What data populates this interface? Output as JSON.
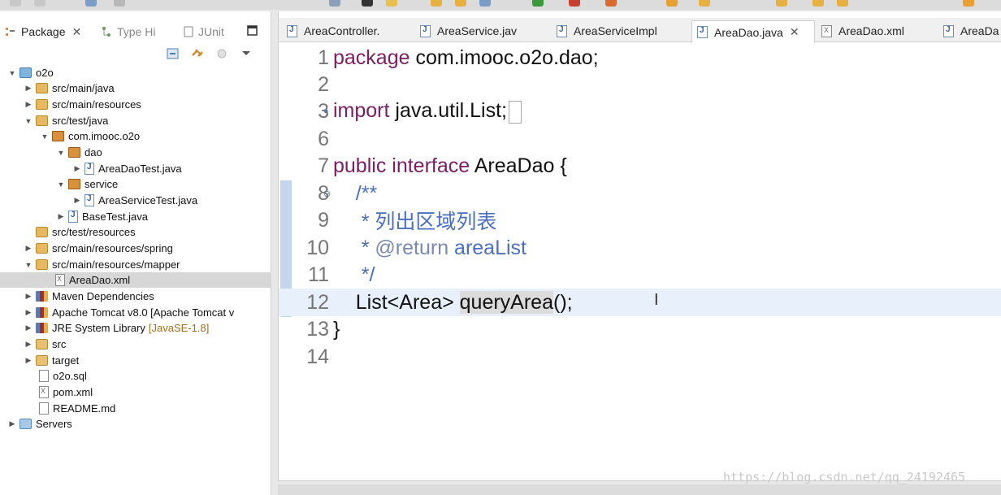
{
  "left_panel": {
    "tabs": [
      {
        "label": "Package",
        "close": "✕"
      },
      {
        "label": "Type Hi"
      },
      {
        "label": "JUnit"
      }
    ],
    "tree": [
      {
        "label": "o2o",
        "arrow": "▼",
        "icon": "project-icon"
      },
      {
        "label": "src/main/java",
        "arrow": "▶",
        "icon": "source-folder-icon"
      },
      {
        "label": "src/main/resources",
        "arrow": "▶",
        "icon": "source-folder-icon"
      },
      {
        "label": "src/test/java",
        "arrow": "▼",
        "icon": "source-folder-icon"
      },
      {
        "label": "com.imooc.o2o",
        "arrow": "▼",
        "icon": "package-icon"
      },
      {
        "label": "dao",
        "arrow": "▼",
        "icon": "package-icon"
      },
      {
        "label": "AreaDaoTest.java",
        "arrow": "▶",
        "icon": "java-file-icon"
      },
      {
        "label": "service",
        "arrow": "▼",
        "icon": "package-icon"
      },
      {
        "label": "AreaServiceTest.java",
        "arrow": "▶",
        "icon": "java-file-icon"
      },
      {
        "label": "BaseTest.java",
        "arrow": "▶",
        "icon": "java-file-icon"
      },
      {
        "label": "src/test/resources",
        "arrow": "",
        "icon": "source-folder-icon"
      },
      {
        "label": "src/main/resources/spring",
        "arrow": "▶",
        "icon": "source-folder-icon"
      },
      {
        "label": "src/main/resources/mapper",
        "arrow": "▼",
        "icon": "source-folder-icon"
      },
      {
        "label": "AreaDao.xml",
        "arrow": "",
        "icon": "xml-file-icon"
      },
      {
        "label": "Maven Dependencies",
        "arrow": "▶",
        "icon": "library-icon"
      },
      {
        "label": "Apache Tomcat v8.0 [Apache Tomcat v",
        "arrow": "▶",
        "icon": "library-icon"
      },
      {
        "label": "JRE System Library",
        "suffix": "[JavaSE-1.8]",
        "arrow": "▶",
        "icon": "library-icon"
      },
      {
        "label": "src",
        "arrow": "▶",
        "icon": "folder-icon"
      },
      {
        "label": "target",
        "arrow": "▶",
        "icon": "folder-icon"
      },
      {
        "label": "o2o.sql",
        "arrow": "",
        "icon": "file-icon"
      },
      {
        "label": "pom.xml",
        "arrow": "",
        "icon": "xml-file-icon"
      },
      {
        "label": "README.md",
        "arrow": "",
        "icon": "file-icon"
      },
      {
        "label": "Servers",
        "arrow": "▶",
        "icon": "servers-folder-icon"
      }
    ]
  },
  "editor": {
    "tabs": [
      {
        "label": "AreaController.",
        "kind": "java"
      },
      {
        "label": "AreaService.jav",
        "kind": "java"
      },
      {
        "label": "AreaServiceImpl",
        "kind": "java"
      },
      {
        "label": "AreaDao.java",
        "kind": "java",
        "close": "✕"
      },
      {
        "label": "AreaDao.xml",
        "kind": "xml"
      },
      {
        "label": "AreaDa",
        "kind": "java"
      }
    ],
    "line_numbers": [
      "1",
      "2",
      "3",
      "6",
      "7",
      "8",
      "9",
      "10",
      "11",
      "12",
      "13",
      "14"
    ],
    "code": {
      "l1_kw": "package",
      "l1_rest": " com.imooc.o2o.dao;",
      "l3_kw": "import",
      "l3_rest": " java.util.List;",
      "l7_kw": "public interface",
      "l7_rest": " AreaDao {",
      "l8": "    /**",
      "l9": "     * 列出区域列表",
      "l10_a": "     * ",
      "l10_tag": "@return",
      "l10_b": " areaList",
      "l11": "     */",
      "l12_a": "    List<Area> ",
      "l12_sel": "queryArea",
      "l12_b": "();",
      "l13": "}"
    },
    "text_cursor": "I"
  },
  "watermark": "https://blog.csdn.net/qq_24192465"
}
